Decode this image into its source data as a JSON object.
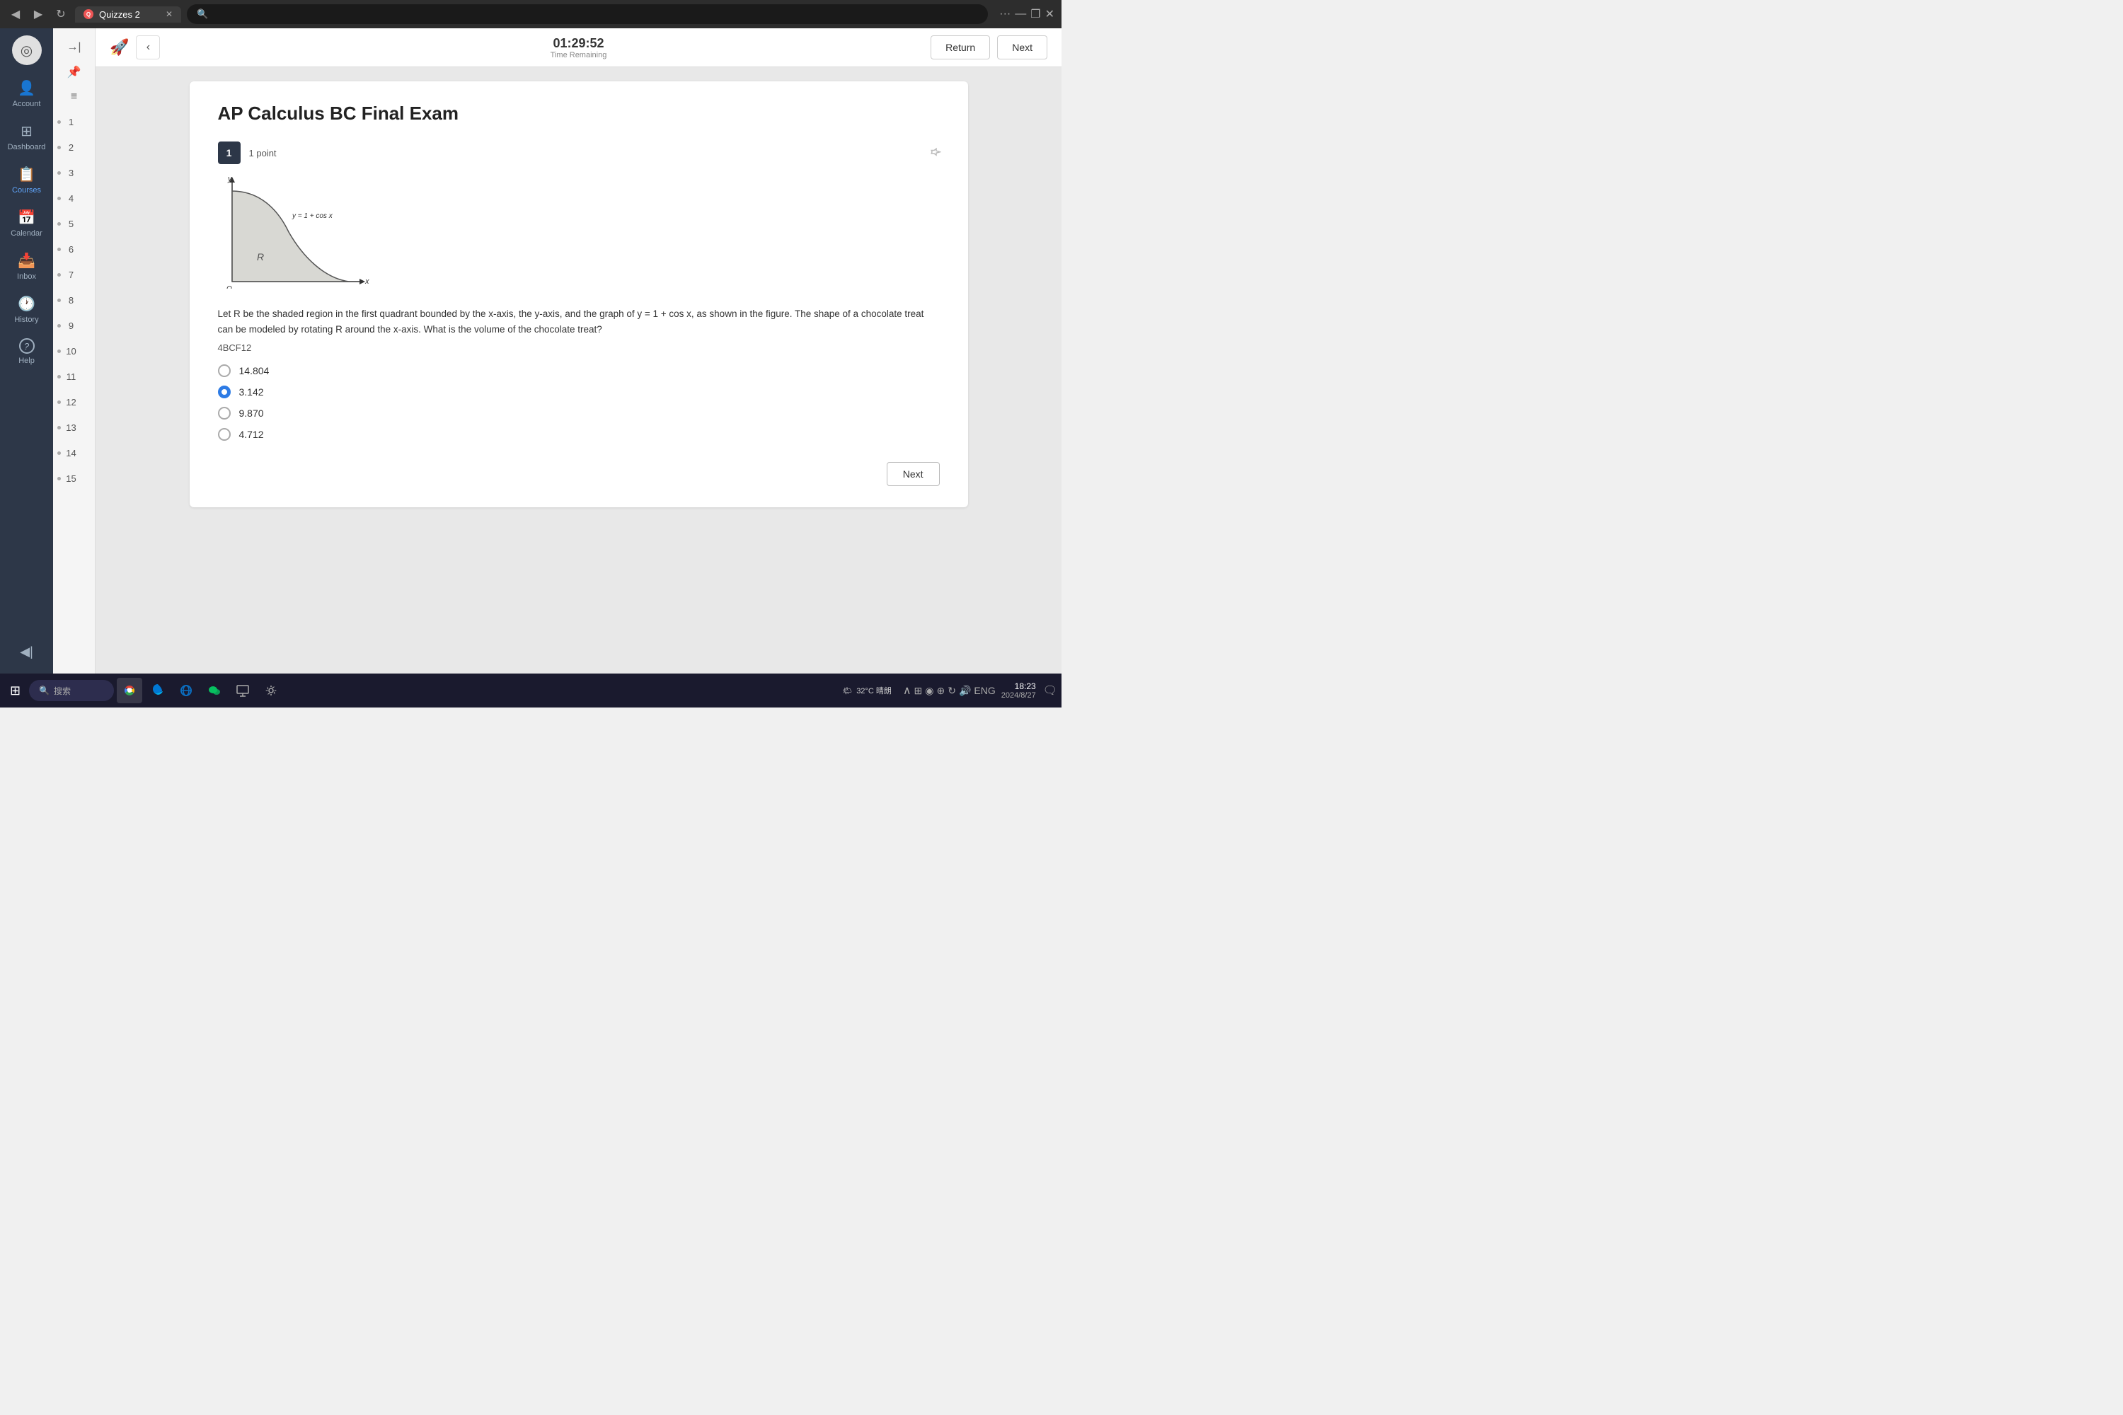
{
  "browser": {
    "tab_title": "Quizzes 2",
    "back_icon": "◀",
    "forward_icon": "▶",
    "reload_icon": "↻",
    "close_tab_icon": "✕",
    "search_icon": "🔍",
    "more_icon": "···",
    "minimize_icon": "—",
    "restore_icon": "❐",
    "close_icon": "✕"
  },
  "sidebar": {
    "logo_icon": "◎",
    "items": [
      {
        "id": "account",
        "label": "Account",
        "icon": "👤"
      },
      {
        "id": "dashboard",
        "label": "Dashboard",
        "icon": "⊞"
      },
      {
        "id": "courses",
        "label": "Courses",
        "icon": "📋"
      },
      {
        "id": "calendar",
        "label": "Calendar",
        "icon": "📅"
      },
      {
        "id": "inbox",
        "label": "Inbox",
        "icon": "📥"
      },
      {
        "id": "history",
        "label": "History",
        "icon": "🕐"
      },
      {
        "id": "help",
        "label": "Help",
        "icon": "?"
      }
    ],
    "collapse_icon": "◀|"
  },
  "question_panel": {
    "collapse_icon": "→|",
    "pin_icon": "📌",
    "list_icon": "≡",
    "numbers": [
      1,
      2,
      3,
      4,
      5,
      6,
      7,
      8,
      9,
      10,
      11,
      12,
      13,
      14,
      15
    ]
  },
  "toolbar": {
    "rocket_icon": "🚀",
    "timer_value": "01:29:52",
    "timer_label": "Time Remaining",
    "chevron_left": "‹",
    "return_label": "Return",
    "next_label": "Next"
  },
  "quiz": {
    "title": "AP Calculus BC Final Exam",
    "question_number": "1",
    "question_points": "1 point",
    "question_text": "Let R be the shaded region in the first quadrant bounded by the x-axis, the y-axis, and the graph of y = 1 + cos x, as shown in the figure. The shape of a chocolate treat can be modeled by rotating R around the x-axis. What is the volume of the chocolate treat?",
    "question_code": "4BCF12",
    "answers": [
      {
        "id": "a",
        "value": "14.804",
        "selected": false
      },
      {
        "id": "b",
        "value": "3.142",
        "selected": true
      },
      {
        "id": "c",
        "value": "9.870",
        "selected": false
      },
      {
        "id": "d",
        "value": "4.712",
        "selected": false
      }
    ],
    "next_button_label": "Next",
    "graph": {
      "equation_label": "y = 1 + cos x",
      "region_label": "R",
      "origin_label": "O",
      "x_axis_label": "x",
      "y_axis_label": "y"
    }
  },
  "taskbar": {
    "start_icon": "⊞",
    "search_placeholder": "搜索",
    "apps": [
      {
        "name": "chrome",
        "color": "#4285f4"
      },
      {
        "name": "edge",
        "color": "#0078d4"
      },
      {
        "name": "ie",
        "color": "#0a6fc2"
      },
      {
        "name": "wechat",
        "color": "#07c160"
      },
      {
        "name": "display",
        "color": "#555"
      },
      {
        "name": "settings",
        "color": "#888"
      }
    ],
    "tray_text": "32°C 晴朗",
    "time": "18:23",
    "date": "2024/8/27"
  }
}
